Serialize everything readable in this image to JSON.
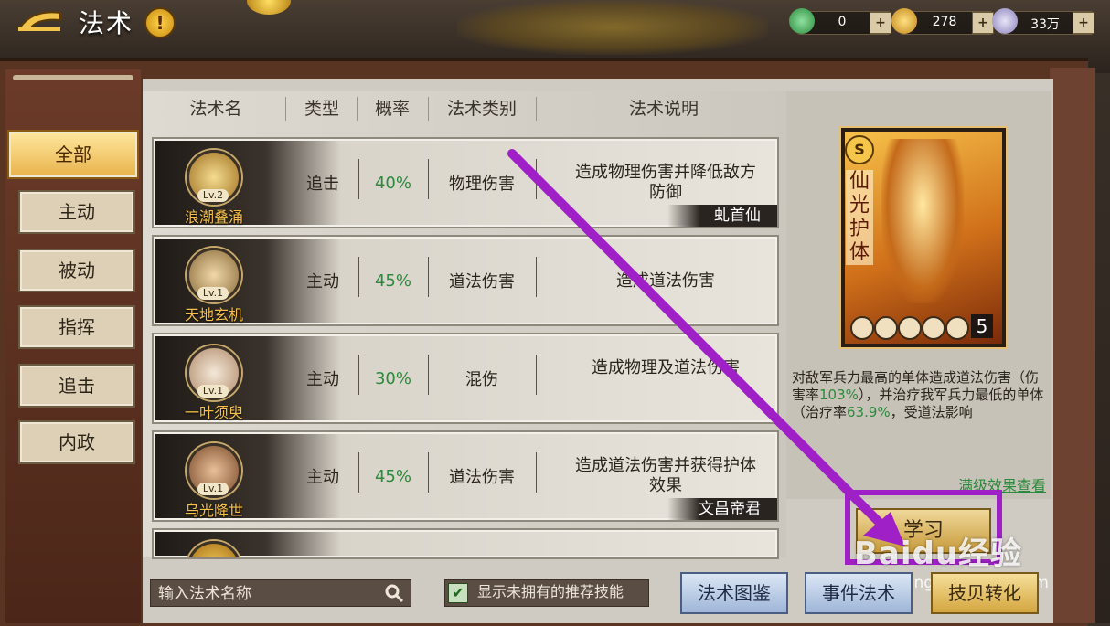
{
  "header": {
    "title": "法术",
    "help_label": "!",
    "resources": [
      {
        "icon": "jade-icon",
        "value": "0",
        "color": "#3aa84a"
      },
      {
        "icon": "gold-ingot-icon",
        "value": "278",
        "color": "#e2a42a"
      },
      {
        "icon": "silver-ingot-icon",
        "value": "33万",
        "color": "#a7a0c8"
      }
    ],
    "plus_label": "+"
  },
  "sidebar": {
    "items": [
      {
        "label": "全部",
        "active": true
      },
      {
        "label": "主动"
      },
      {
        "label": "被动"
      },
      {
        "label": "指挥"
      },
      {
        "label": "追击"
      },
      {
        "label": "内政"
      }
    ]
  },
  "table": {
    "headers": [
      "法术名",
      "类型",
      "概率",
      "法术类别",
      "法术说明"
    ],
    "rows": [
      {
        "name": "浪潮叠涌",
        "level": "Lv.2",
        "type": "追击",
        "rate": "40%",
        "category": "物理伤害",
        "desc": "造成物理伤害并降低敌方防御",
        "tag": "虬首仙",
        "icon_color": "#d7b04a"
      },
      {
        "name": "天地玄机",
        "level": "Lv.1",
        "type": "主动",
        "rate": "45%",
        "category": "道法伤害",
        "desc": "造成道法伤害",
        "tag": "",
        "icon_color": "#c9a25a"
      },
      {
        "name": "一叶须臾",
        "level": "Lv.1",
        "type": "主动",
        "rate": "30%",
        "category": "混伤",
        "desc": "造成物理及道法伤害",
        "tag": "",
        "icon_color": "#dcc7a8"
      },
      {
        "name": "乌光降世",
        "level": "Lv.1",
        "type": "主动",
        "rate": "45%",
        "category": "道法伤害",
        "desc": "造成道法伤害并获得护体效果",
        "tag": "文昌帝君",
        "icon_color": "#b9784a"
      }
    ]
  },
  "detail": {
    "card_name": "仙光护体",
    "card_rank": "S",
    "card_level": "5",
    "desc_part1": "对敌军兵力最高的单体造成道法伤害（伤害率",
    "desc_num1": "103%",
    "desc_part2": "），并治疗我军兵力最低的单体（治疗率",
    "desc_num2": "63.9%",
    "desc_part3": "，受道法影响",
    "full_effect_link": "满级效果查看",
    "learn_button": "学习"
  },
  "bottom": {
    "search_placeholder": "输入法术名称",
    "toggle_label": "显示未拥有的推荐技能",
    "btn_codex": "法术图鉴",
    "btn_event": "事件法术",
    "btn_convert": "技贝转化"
  },
  "watermark": {
    "text": "Baidu经验",
    "sub": "jingyan.baidu.com"
  },
  "annotation_color": "#a020c8"
}
